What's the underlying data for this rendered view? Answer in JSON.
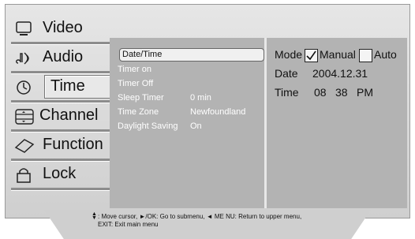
{
  "main_menu": {
    "items": [
      {
        "label": "Video",
        "icon": "monitor-icon"
      },
      {
        "label": "Audio",
        "icon": "music-note-icon"
      },
      {
        "label": "Time",
        "icon": "clock-icon",
        "selected": true
      },
      {
        "label": "Channel",
        "icon": "channel-icon"
      },
      {
        "label": "Function",
        "icon": "diamond-icon"
      },
      {
        "label": "Lock",
        "icon": "lock-icon"
      }
    ]
  },
  "submenu": {
    "items": [
      {
        "label": "Date/Time",
        "value": "",
        "selected": true
      },
      {
        "label": "Timer on",
        "value": ""
      },
      {
        "label": "Timer Off",
        "value": ""
      },
      {
        "label": "Sleep Timer",
        "value": "0 min"
      },
      {
        "label": "Time Zone",
        "value": "Newfoundland"
      },
      {
        "label": "Daylight Saving",
        "value": "On"
      }
    ]
  },
  "details": {
    "mode_label": "Mode",
    "manual_label": "Manual",
    "auto_label": "Auto",
    "manual_checked": true,
    "auto_checked": false,
    "date_label": "Date",
    "date_value": "2004.12.31",
    "time_label": "Time",
    "time_hour": "08",
    "time_minute": "38",
    "time_period": "PM"
  },
  "footer": {
    "line1": ": Move cursor,  ►/OK: Go to submenu,  ◄ ME NU: Return to upper menu,",
    "line2": "EXIT: Exit main menu"
  },
  "colors": {
    "panel_gray": "#b3b3b3",
    "frame_gray": "#d8d8d8",
    "text_white": "#ffffff",
    "text_dark": "#111111"
  }
}
